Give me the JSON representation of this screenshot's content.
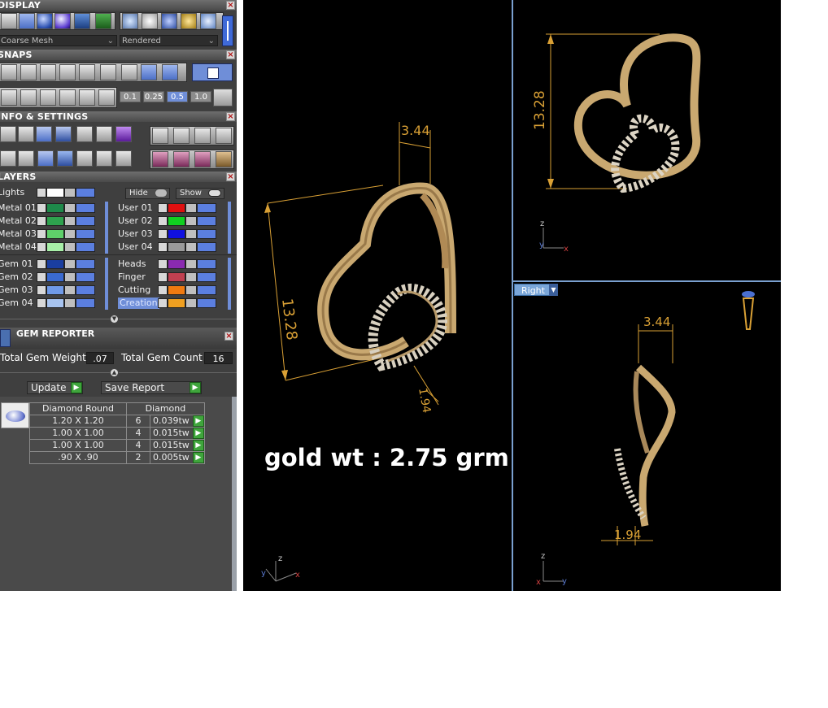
{
  "display": {
    "title": "DISPLAY",
    "mesh_select": "Coarse Mesh",
    "render_select": "Rendered"
  },
  "snaps": {
    "title": "SNAPS",
    "values": [
      "0.1",
      "0.25",
      "0.5",
      "1.0"
    ],
    "selected_value": "0.5"
  },
  "info_settings": {
    "title": "INFO & SETTINGS"
  },
  "layers": {
    "title": "LAYERS",
    "hide_label": "Hide",
    "show_label": "Show",
    "lights": {
      "name": "Lights",
      "color": "#ffffff"
    },
    "metal": [
      {
        "name": "Metal 01",
        "color": "#1e8a4a"
      },
      {
        "name": "Metal 02",
        "color": "#2ea24e"
      },
      {
        "name": "Metal 03",
        "color": "#5fd06a"
      },
      {
        "name": "Metal 04",
        "color": "#a8f0a8"
      }
    ],
    "user": [
      {
        "name": "User 01",
        "color": "#e01010"
      },
      {
        "name": "User 02",
        "color": "#10d020"
      },
      {
        "name": "User 03",
        "color": "#1010e0"
      },
      {
        "name": "User 04",
        "color": "#9a9a9a"
      }
    ],
    "gem": [
      {
        "name": "Gem 01",
        "color": "#1a3ea0"
      },
      {
        "name": "Gem 02",
        "color": "#3a6ad0"
      },
      {
        "name": "Gem 03",
        "color": "#6f9ae8"
      },
      {
        "name": "Gem 04",
        "color": "#a8c4f0"
      }
    ],
    "other": [
      {
        "name": "Heads",
        "color": "#8a2ab0"
      },
      {
        "name": "Finger",
        "color": "#c04050"
      },
      {
        "name": "Cutting",
        "color": "#f07a10"
      },
      {
        "name": "Creation",
        "color": "#f0a020"
      }
    ]
  },
  "gem_reporter": {
    "title": "GEM REPORTER",
    "total_weight_label": "Total Gem Weight",
    "total_weight_value": ".07",
    "total_count_label": "Total Gem Count",
    "total_count_value": "16",
    "update_label": "Update",
    "save_report_label": "Save Report",
    "table_header": [
      "Diamond Round",
      "Diamond"
    ],
    "rows": [
      {
        "size": "1.20 X 1.20",
        "count": "6",
        "weight": "0.039tw"
      },
      {
        "size": "1.00 X 1.00",
        "count": "4",
        "weight": "0.015tw"
      },
      {
        "size": "1.00 X 1.00",
        "count": "4",
        "weight": "0.015tw"
      },
      {
        "size": ".90 X .90",
        "count": "2",
        "weight": "0.005tw"
      }
    ]
  },
  "viewports": {
    "perspective": {
      "dims": [
        "3.44",
        "13.28",
        "1.94"
      ],
      "caption": "gold wt : 2.75 grm"
    },
    "front": {
      "dims": [
        "13.28"
      ]
    },
    "right": {
      "view_name": "Right",
      "dims": [
        "3.44",
        "1.94"
      ]
    },
    "axes": {
      "x": "x",
      "y": "y",
      "z": "z"
    }
  }
}
